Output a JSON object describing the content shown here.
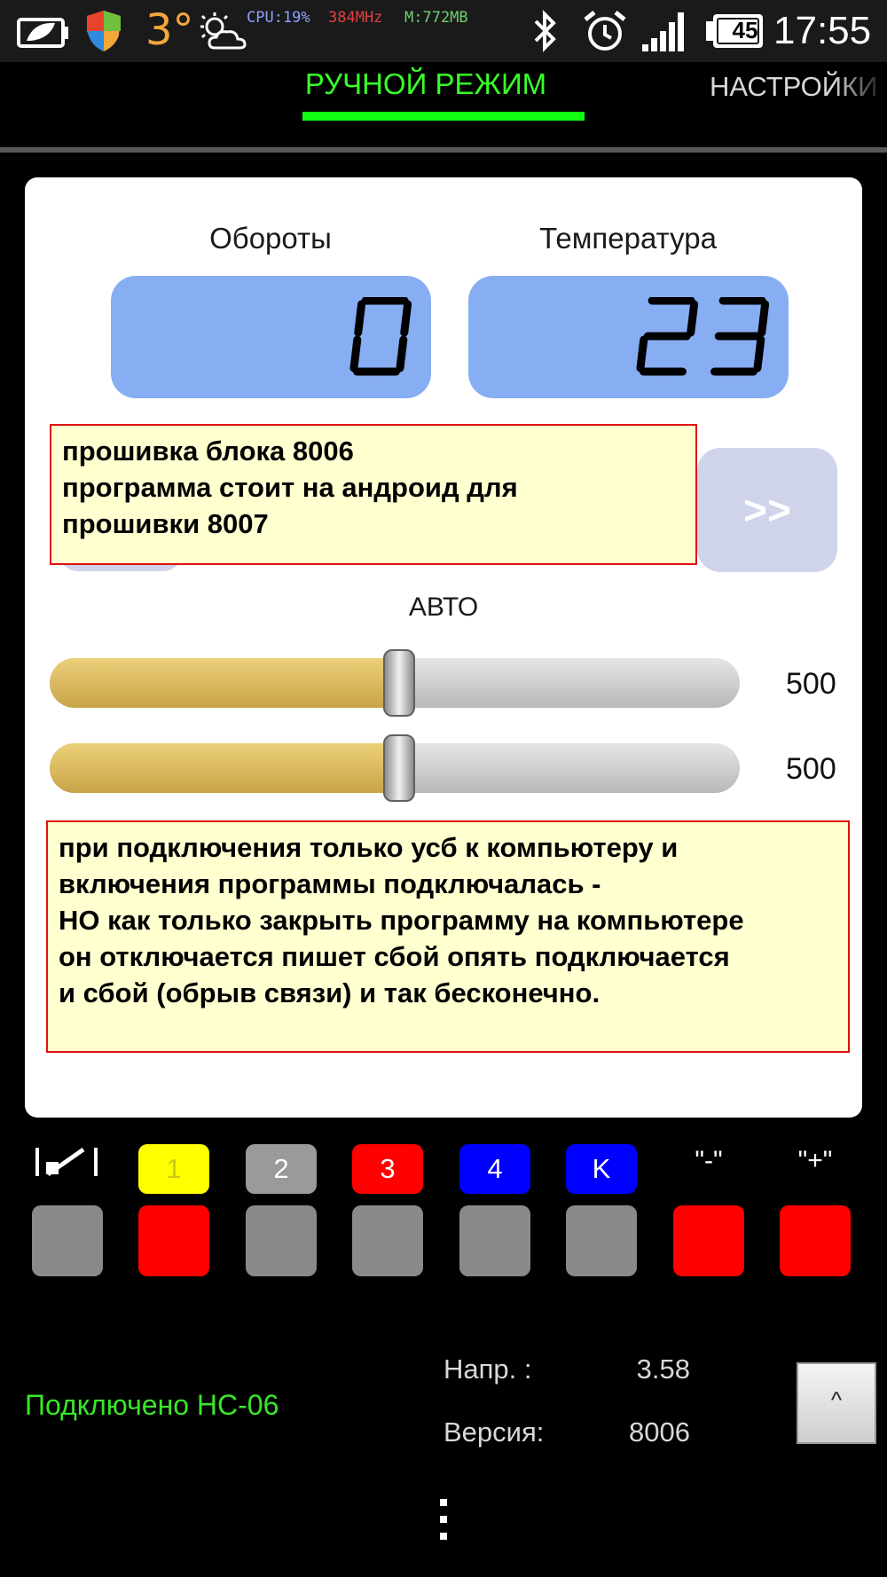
{
  "status_bar": {
    "temperature": "3°",
    "cpu": "CPU:19%",
    "freq": "384MHz",
    "memory": "M:772MB",
    "battery": "45",
    "time": "17:55",
    "icons": [
      "battery-leaf-icon",
      "shield-icon",
      "weather-cloud-icon",
      "bluetooth-icon",
      "alarm-icon",
      "signal-icon",
      "battery-icon"
    ]
  },
  "tabs": {
    "manual": "РУЧНОЙ РЕЖИМ",
    "settings": "НАСТРОЙКИ"
  },
  "gauges": {
    "rpm_label": "Обороты",
    "rpm_value": "0",
    "temp_label": "Температура",
    "temp_value": "23"
  },
  "notes": {
    "top": [
      "прошивка блока 8006",
      "программа стоит на андроид для",
      "прошивки 8007"
    ],
    "bottom": [
      "при подключения только усб к компьютеру и",
      "включения программы подключалась -",
      "НО как только закрыть программу на компьютере",
      "он отключается пишет сбой опять подключается",
      "и сбой (обрыв связи) и так бесконечно."
    ]
  },
  "next_button": ">>",
  "auto_label": "АВТО",
  "sliders": [
    {
      "value": "500",
      "fraction": 0.5
    },
    {
      "value": "500",
      "fraction": 0.5
    }
  ],
  "channels": {
    "labels": [
      "1",
      "2",
      "3",
      "4",
      "K",
      "\"-\"",
      "\"+\""
    ],
    "button_states": [
      "gray",
      "red",
      "gray",
      "gray",
      "gray",
      "gray",
      "red",
      "red"
    ]
  },
  "info": {
    "connection": "Подключено HC-06",
    "voltage_label": "Напр. :",
    "voltage_value": "3.58",
    "version_label": "Версия:",
    "version_value": "8006"
  },
  "up_button": "^",
  "colors": {
    "accent_green": "#39ff29",
    "lcd_blue": "#87adf3",
    "note_bg": "#ffffd0",
    "note_border": "#e01010"
  }
}
